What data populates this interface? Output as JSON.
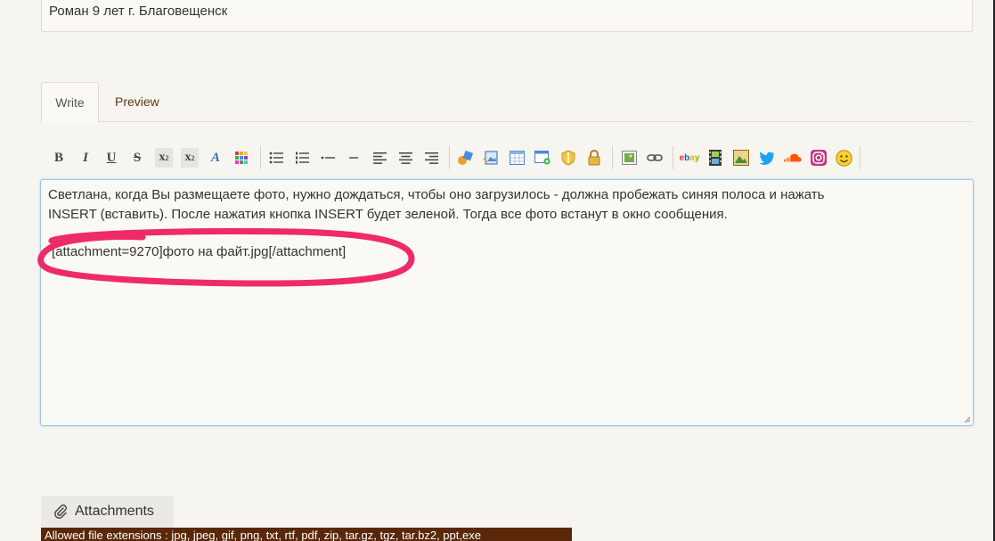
{
  "top_panel": {
    "text": "Роман 9 лет г. Благовещенск"
  },
  "tabs": [
    {
      "label": "Write",
      "active": true
    },
    {
      "label": "Preview",
      "active": false
    }
  ],
  "toolbar": {
    "bold": "B",
    "italic": "I",
    "underline": "U",
    "strike": "S",
    "subscript": "x",
    "superscript": "x",
    "icons": [
      "bold-icon",
      "italic-icon",
      "underline-icon",
      "strikethrough-icon",
      "subscript-icon",
      "superscript-icon",
      "font-icon",
      "color-palette-icon",
      "bullet-list-icon",
      "numbered-list-icon",
      "outdent-icon",
      "indent-icon",
      "align-left-icon",
      "align-center-icon",
      "align-right-icon",
      "media-icon",
      "image-link-icon",
      "table-icon",
      "window-add-icon",
      "shield-icon",
      "lock-icon",
      "image-icon",
      "link-icon",
      "ebay-icon",
      "film-icon",
      "picture-icon",
      "twitter-icon",
      "soundcloud-icon",
      "instagram-icon",
      "smiley-icon"
    ]
  },
  "editor": {
    "line1": "Светлана, когда Вы размещаете фото, нужно дождаться, чтобы оно загрузилось - должна пробежать синяя полоса и нажать",
    "line2": "INSERT (вставить). После нажатия кнопка INSERT будет зеленой. Тогда все фото встанут в окно сообщения.",
    "attachment_tag": "[attachment=9270]фото на файт.jpg[/attachment]"
  },
  "colors": {
    "highlight": "#ee2a6a",
    "editor_border": "#9fc3e4",
    "allowed_bar": "#5a2808"
  },
  "attachments": {
    "button_label": "Attachments",
    "allowed_text": "Allowed file extensions : jpg, jpeg, gif, png, txt, rtf, pdf, zip, tar.gz, tgz, tar.bz2, ppt,exe"
  }
}
